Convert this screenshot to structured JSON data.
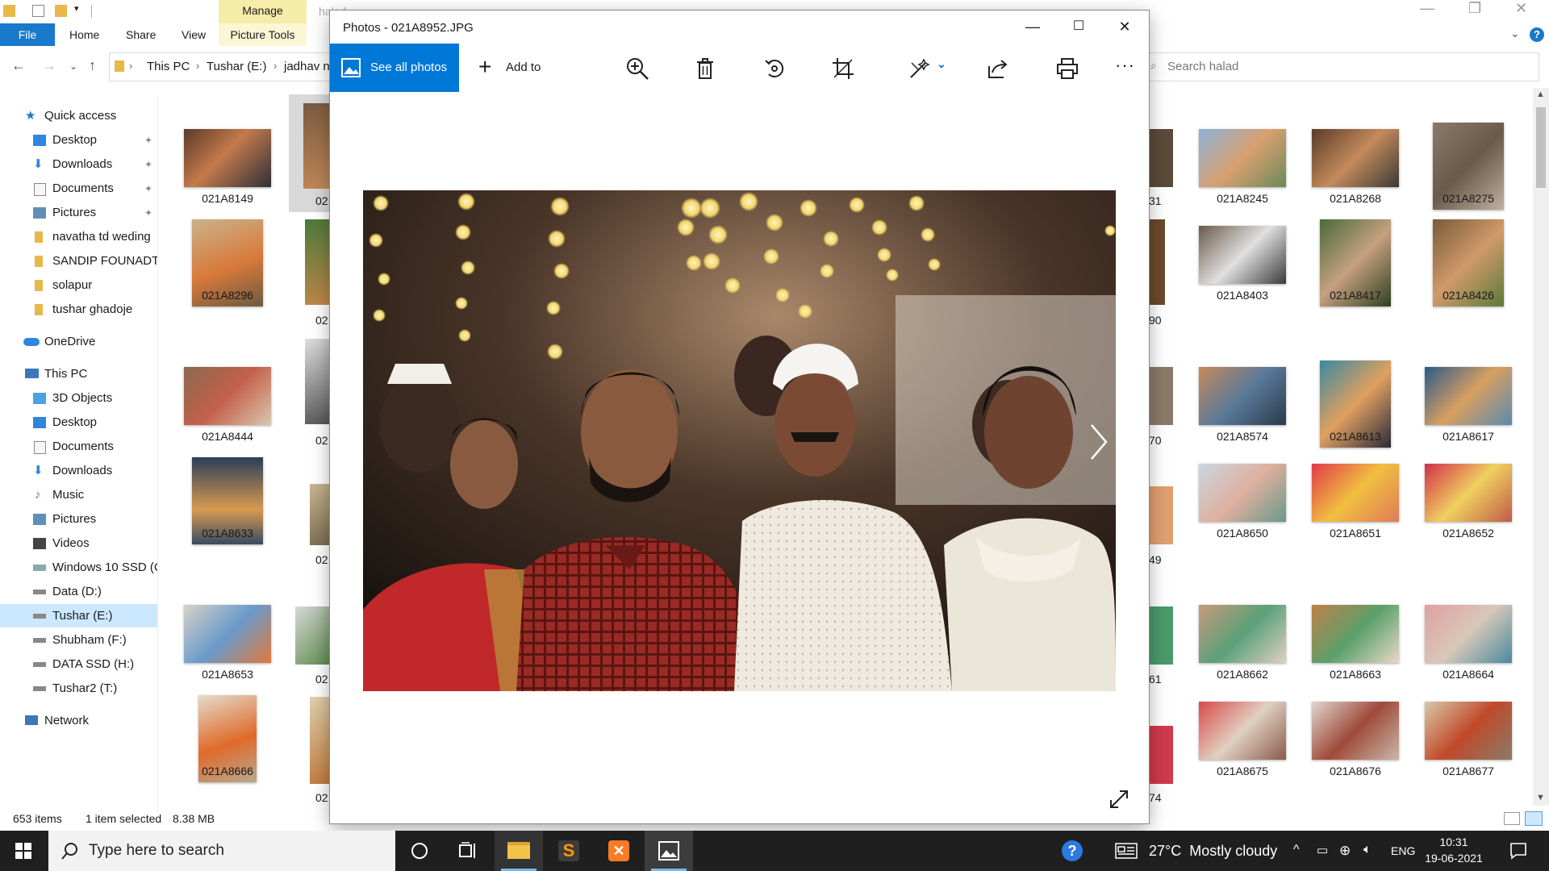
{
  "explorer": {
    "context_tab": "Manage",
    "faded_title": "halad",
    "tabs": [
      "File",
      "Home",
      "Share",
      "View",
      "Picture Tools"
    ],
    "breadcrumb": [
      "This PC",
      "Tushar (E:)",
      "jadhav n"
    ],
    "search_placeholder": "Search halad",
    "nav": {
      "quick_access": "Quick access",
      "quick_items": [
        "Desktop",
        "Downloads",
        "Documents",
        "Pictures",
        "navatha td weding",
        "SANDIP FOUNADTI",
        "solapur",
        "tushar ghadoje"
      ],
      "onedrive": "OneDrive",
      "this_pc": "This PC",
      "pc_items": [
        "3D Objects",
        "Desktop",
        "Documents",
        "Downloads",
        "Music",
        "Pictures",
        "Videos",
        "Windows 10 SSD (C",
        "Data (D:)",
        "Tushar (E:)",
        "Shubham (F:)",
        "DATA SSD (H:)",
        "Tushar2 (T:)"
      ],
      "network": "Network"
    },
    "left_thumbs": [
      "021A8149",
      "021A8296",
      "021A8444",
      "021A8633",
      "021A8653",
      "021A8666"
    ],
    "left_partial": [
      "02",
      "02",
      "02",
      "02",
      "02",
      "02"
    ],
    "right_partial": [
      "31",
      "90",
      "70",
      "49",
      "61",
      "74"
    ],
    "right_grid": [
      [
        "021A8245",
        "021A8268",
        "021A8275"
      ],
      [
        "021A8403",
        "021A8417",
        "021A8426"
      ],
      [
        "021A8574",
        "021A8613",
        "021A8617"
      ],
      [
        "021A8650",
        "021A8651",
        "021A8652"
      ],
      [
        "021A8662",
        "021A8663",
        "021A8664"
      ],
      [
        "021A8675",
        "021A8676",
        "021A8677"
      ]
    ],
    "status": {
      "items": "653 items",
      "selected": "1 item selected",
      "size": "8.38 MB"
    }
  },
  "photos": {
    "title": "Photos - 021A8952.JPG",
    "see_all": "See all photos",
    "add_to": "Add to"
  },
  "taskbar": {
    "search_placeholder": "Type here to search",
    "weather": "27°C  Mostly cloudy",
    "lang": "ENG",
    "time": "10:31",
    "date": "19-06-2021"
  },
  "colors": {
    "accent": "#0078d7",
    "file_tab": "#1979ca",
    "manage_tab": "#f6eca9",
    "taskbar": "#1f1f1f"
  }
}
